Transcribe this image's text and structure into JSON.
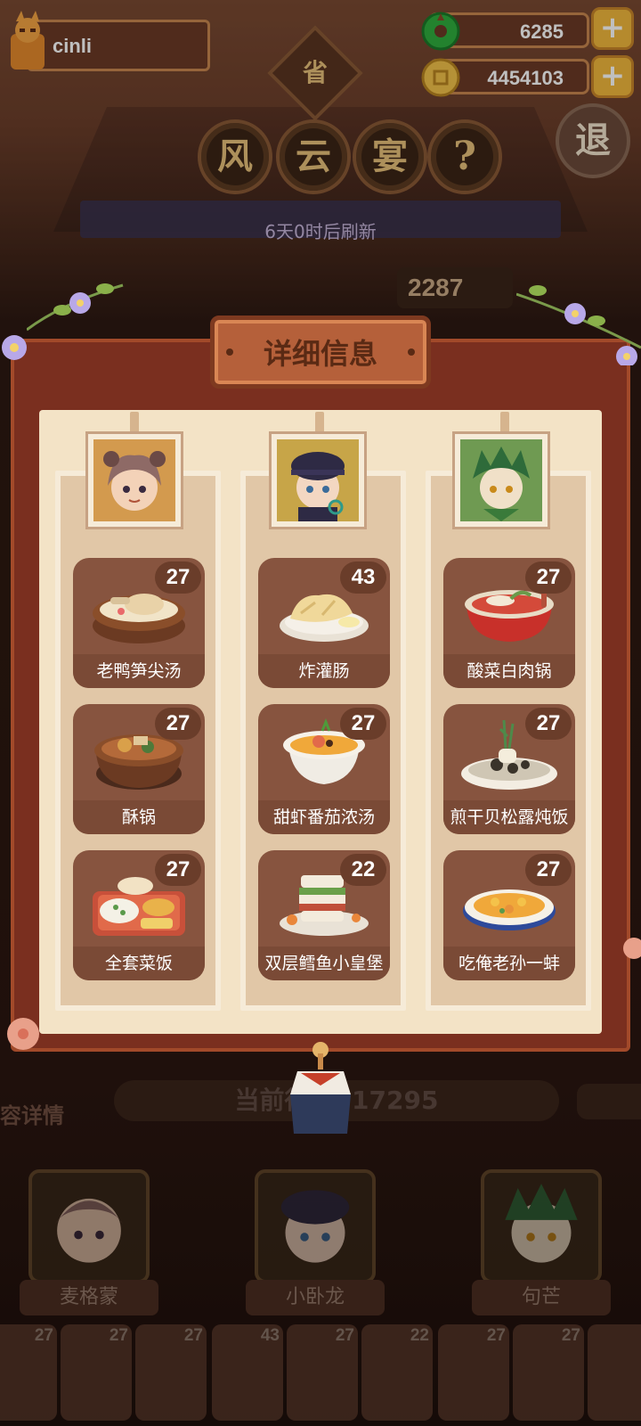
{
  "player": {
    "name": "cinli"
  },
  "currencies": [
    {
      "name": "jade",
      "amount": "6285",
      "icon": "jade-coin-icon"
    },
    {
      "name": "coin",
      "amount": "4454103",
      "icon": "gold-coin-icon"
    }
  ],
  "header": {
    "province_char": "省",
    "title_chars": [
      "风",
      "云",
      "宴"
    ],
    "help_label": "?",
    "exit_label": "退",
    "refresh_text": "6天0时后刷新",
    "score_partial": "2287"
  },
  "panel": {
    "title": "详细信息",
    "columns": [
      {
        "chef_icon": "chef-portrait-maigemeng",
        "dishes": [
          {
            "name": "老鸭笋尖汤",
            "count": "27",
            "icon": "duck-soup-icon"
          },
          {
            "name": "酥锅",
            "count": "27",
            "icon": "clay-pot-icon"
          },
          {
            "name": "全套菜饭",
            "count": "27",
            "icon": "rice-set-icon"
          }
        ]
      },
      {
        "chef_icon": "chef-portrait-xiaowolong",
        "dishes": [
          {
            "name": "炸灌肠",
            "count": "43",
            "icon": "fried-sausage-icon"
          },
          {
            "name": "甜虾番茄浓汤",
            "count": "27",
            "icon": "shrimp-soup-icon"
          },
          {
            "name": "双层鳕鱼小皇堡",
            "count": "22",
            "icon": "fish-burger-icon"
          }
        ]
      },
      {
        "chef_icon": "chef-portrait-goumang",
        "dishes": [
          {
            "name": "酸菜白肉锅",
            "count": "27",
            "icon": "pickled-pot-icon"
          },
          {
            "name": "煎干贝松露炖饭",
            "count": "27",
            "icon": "scallop-risotto-icon"
          },
          {
            "name": "吃俺老孙一蚌",
            "count": "27",
            "icon": "clam-dish-icon"
          }
        ]
      }
    ]
  },
  "footer": {
    "details_label": "容详情",
    "score_prefix": "当前得分",
    "score_value": "917295",
    "chefs": [
      {
        "name": "麦格蒙"
      },
      {
        "name": "小卧龙"
      },
      {
        "name": "句芒"
      }
    ],
    "mini_counts": [
      "27",
      "27",
      "27",
      "43",
      "27",
      "22",
      "27",
      "27",
      ""
    ]
  },
  "colors": {
    "panel_red": "#7a2f1f",
    "paper": "#f3e3c6",
    "card_brown": "#87543f",
    "accent_gold": "#f2b83c"
  }
}
